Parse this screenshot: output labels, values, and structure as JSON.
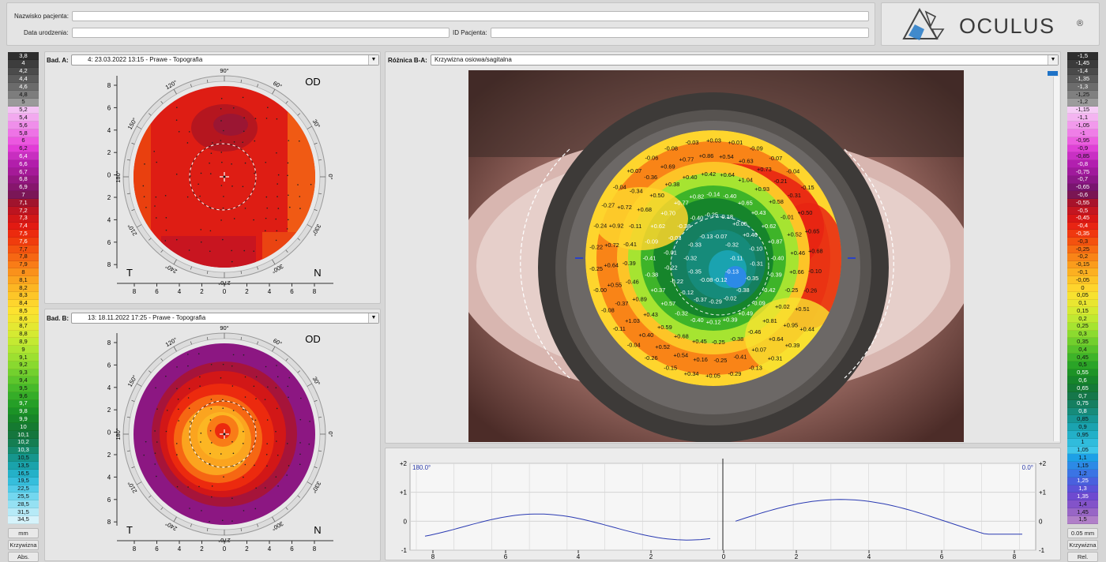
{
  "patient": {
    "name_label": "Nazwisko pacjenta:",
    "name_value": "",
    "dob_label": "Data urodzenia:",
    "dob_value": "",
    "id_label": "ID Pacjenta:",
    "id_value": ""
  },
  "logo": {
    "text": "OCULUS",
    "mark": "®"
  },
  "left_scale": {
    "values": [
      "3,8",
      "4",
      "4,2",
      "4,4",
      "4,6",
      "4,8",
      "5",
      "5,2",
      "5,4",
      "5,6",
      "5,8",
      "6",
      "6,2",
      "6,4",
      "6,6",
      "6,7",
      "6,8",
      "6,9",
      "7",
      "7,1",
      "7,2",
      "7,3",
      "7,4",
      "7,5",
      "7,6",
      "7,7",
      "7,8",
      "7,9",
      "8",
      "8,1",
      "8,2",
      "8,3",
      "8,4",
      "8,5",
      "8,6",
      "8,7",
      "8,8",
      "8,9",
      "9",
      "9,1",
      "9,2",
      "9,3",
      "9,4",
      "9,5",
      "9,6",
      "9,7",
      "9,8",
      "9,9",
      "10",
      "10,1",
      "10,2",
      "10,3",
      "10,5",
      "13,5",
      "16,5",
      "19,5",
      "22,5",
      "25,5",
      "28,5",
      "31,5",
      "34,5"
    ],
    "colors": [
      "#2d2d2d",
      "#3d3d3d",
      "#4b4b4b",
      "#5b5b5b",
      "#6b6b6b",
      "#7d7d7d",
      "#9a9a9a",
      "#f4c2f4",
      "#f2a9ef",
      "#ef8fea",
      "#ee73e6",
      "#ec57e0",
      "#e23cd7",
      "#c82ec0",
      "#b21eab",
      "#a51a98",
      "#931780",
      "#86166c",
      "#7a1657",
      "#a0142d",
      "#bd1420",
      "#d21717",
      "#e21a12",
      "#ec2a0e",
      "#f03c0d",
      "#f3520f",
      "#f66713",
      "#f97c17",
      "#fa911b",
      "#fba41f",
      "#fcb623",
      "#fdc628",
      "#fed52d",
      "#fde22f",
      "#f2e530",
      "#e4e832",
      "#d5ea32",
      "#c4ea32",
      "#b0e632",
      "#9de030",
      "#89d92f",
      "#73d02e",
      "#5dc62c",
      "#47ba2a",
      "#35ad28",
      "#259f27",
      "#1b9226",
      "#178529",
      "#157a31",
      "#15763d",
      "#157e52",
      "#158a6e",
      "#16968d",
      "#1aa3ab",
      "#24b1c8",
      "#36bedc",
      "#52cbe8",
      "#73d7ef",
      "#95e1f3",
      "#b6eaf7",
      "#d6f3fb"
    ],
    "buttons": {
      "unit": "mm",
      "mode": "Krzywizna",
      "abs": "Abs."
    }
  },
  "right_scale": {
    "values": [
      "-1,5",
      "-1,45",
      "-1,4",
      "-1,35",
      "-1,3",
      "-1,25",
      "-1,2",
      "-1,15",
      "-1,1",
      "-1,05",
      "-1",
      "-0,95",
      "-0,9",
      "-0,85",
      "-0,8",
      "-0,75",
      "-0,7",
      "-0,65",
      "-0,6",
      "-0,55",
      "-0,5",
      "-0,45",
      "-0,4",
      "-0,35",
      "-0,3",
      "-0,25",
      "-0,2",
      "-0,15",
      "-0,1",
      "-0,05",
      "0",
      "0,05",
      "0,1",
      "0,15",
      "0,2",
      "0,25",
      "0,3",
      "0,35",
      "0,4",
      "0,45",
      "0,5",
      "0,55",
      "0,6",
      "0,65",
      "0,7",
      "0,75",
      "0,8",
      "0,85",
      "0,9",
      "0,95",
      "1",
      "1,05",
      "1,1",
      "1,15",
      "1,2",
      "1,25",
      "1,3",
      "1,35",
      "1,4",
      "1,45",
      "1,5"
    ],
    "colors": [
      "#2d2d2d",
      "#3b3b3b",
      "#4a4a4a",
      "#5a5a5a",
      "#6c6c6c",
      "#808080",
      "#9c9c9c",
      "#f6cdf6",
      "#f4b4f1",
      "#f29aec",
      "#ef7ee7",
      "#ec5fe0",
      "#df41d6",
      "#c930c4",
      "#b21faf",
      "#a01a9c",
      "#8c1787",
      "#79156f",
      "#7a1553",
      "#a8132b",
      "#c41620",
      "#d91715",
      "#e82413",
      "#f0380f",
      "#f4520f",
      "#f76c13",
      "#f98417",
      "#fb9c1c",
      "#fcb021",
      "#fdc427",
      "#fed52d",
      "#f7e22f",
      "#e9e631",
      "#d6ea32",
      "#c0e932",
      "#a6e431",
      "#8cdb2f",
      "#72cf2d",
      "#57c22b",
      "#3eb429",
      "#2aa427",
      "#1d9326",
      "#16852b",
      "#147a36",
      "#15774a",
      "#157f60",
      "#168b7a",
      "#169695",
      "#1aa3b0",
      "#23b0c8",
      "#30bcdc",
      "#3fc6ea",
      "#1da0e6",
      "#2c8ae6",
      "#3b74e4",
      "#4a60de",
      "#5b52d8",
      "#6e4ad0",
      "#8353c9",
      "#9866c6",
      "#b07fc8"
    ],
    "buttons": {
      "unit": "0.05 mm",
      "mode": "Krzywizna",
      "rel": "Rel."
    }
  },
  "exam_a": {
    "label": "Bad. A:",
    "value": "4: 23.03.2022 13:15 - Prawe - Topografia",
    "eye": "OD",
    "left_letter": "T",
    "right_letter": "N",
    "y_ticks": [
      "8",
      "6",
      "4",
      "2",
      "0",
      "2",
      "4",
      "6",
      "8"
    ],
    "x_ticks": [
      "8",
      "6",
      "4",
      "2",
      "0",
      "2",
      "4",
      "6",
      "8"
    ],
    "angles": [
      "90°",
      "60°",
      "30°",
      "0°",
      "330°",
      "300°",
      "270°",
      "240°",
      "210°",
      "180°",
      "150°",
      "120°"
    ]
  },
  "exam_b": {
    "label": "Bad. B:",
    "value": "13: 18.11.2022 17:25 - Prawe - Topografia",
    "eye": "OD",
    "left_letter": "T",
    "right_letter": "N",
    "y_ticks": [
      "8",
      "6",
      "4",
      "2",
      "0",
      "2",
      "4",
      "6",
      "8"
    ],
    "x_ticks": [
      "8",
      "6",
      "4",
      "2",
      "0",
      "2",
      "4",
      "6",
      "8"
    ],
    "angles": [
      "90°",
      "60°",
      "30°",
      "0°",
      "330°",
      "300°",
      "270°",
      "240°",
      "210°",
      "180°",
      "150°",
      "120°"
    ]
  },
  "difference": {
    "label": "Różnica B-A:",
    "value": "Krzywizna osiowa/sagitalna",
    "grid_values": [
      "-0.11",
      "-0.13",
      "-0.12",
      "-0.08",
      "-0.35",
      "-0.32",
      "-0.33",
      "-0.13",
      "-0.07",
      "-0.32",
      "-0.31",
      "-0.35",
      "-0.38",
      "-0.02",
      "-0.29",
      "-0.37",
      "-0.12",
      "-0.22",
      "-0.22",
      "-0.01",
      "-0.03",
      "-0.38",
      "-0.40",
      "-0.25",
      "-0.18",
      "+0.05",
      "+0.46",
      "-0.10",
      "-0.39",
      "-0.42",
      "-0.09",
      "+0.49",
      "+0.39",
      "+0.12",
      "-0.40",
      "-0.32",
      "+0.57",
      "+0.37",
      "-0.38",
      "-0.41",
      "-0.09",
      "+0.62",
      "+0.70",
      "+0.77",
      "+0.82",
      "-0.14",
      "-0.40",
      "+0.65",
      "+0.43",
      "+0.62",
      "+0.87",
      "-0.40",
      "-0.25",
      "+0.02",
      "+0.81",
      "-0.46",
      "-0.38",
      "-0.25",
      "+0.45",
      "+0.68",
      "+0.59",
      "+0.43",
      "+0.89",
      "-0.46",
      "-0.39",
      "-0.41",
      "-0.11",
      "+0.68",
      "+0.50",
      "+0.38",
      "+0.40",
      "+0.42",
      "+0.64",
      "+1.04",
      "+0.93",
      "+0.58",
      "-0.01",
      "+0.52",
      "+0.46",
      "+0.66",
      "+0.51",
      "+0.95",
      "+0.64",
      "+0.07",
      "-0.41",
      "-0.25",
      "+0.16",
      "+0.54",
      "+0.52",
      "+0.40",
      "+1.03",
      "-0.37",
      "+0.55",
      "+0.64",
      "+0.72",
      "+0.92",
      "+0.72",
      "-0.34",
      "-0.36",
      "+0.69",
      "+0.77",
      "+0.86",
      "+0.54",
      "+0.63",
      "+0.73",
      "-0.21",
      "-0.31",
      "+0.50",
      "+0.65",
      "+0.68",
      "-0.10",
      "-0.26",
      "+0.44",
      "+0.39",
      "+0.31",
      "-0.13",
      "-0.29",
      "+0.05",
      "+0.34",
      "-0.15",
      "-0.26",
      "-0.04",
      "-0.11",
      "-0.08",
      "-0.00",
      "-0.25",
      "-0.22",
      "-0.24",
      "-0.27",
      "-0.04",
      "+0.07",
      "-0.06",
      "-0.08",
      "-0.03",
      "+0.03",
      "+0.01",
      "-0.09",
      "-0.07",
      "-0.04",
      "-0.15"
    ]
  },
  "profile": {
    "left_angle": "180.0°",
    "right_angle": "0.0°",
    "y_labels": [
      "+2",
      "+1",
      "0",
      "-1"
    ],
    "x_labels": [
      "8",
      "6",
      "4",
      "2",
      "0",
      "2",
      "4",
      "6",
      "8"
    ]
  }
}
